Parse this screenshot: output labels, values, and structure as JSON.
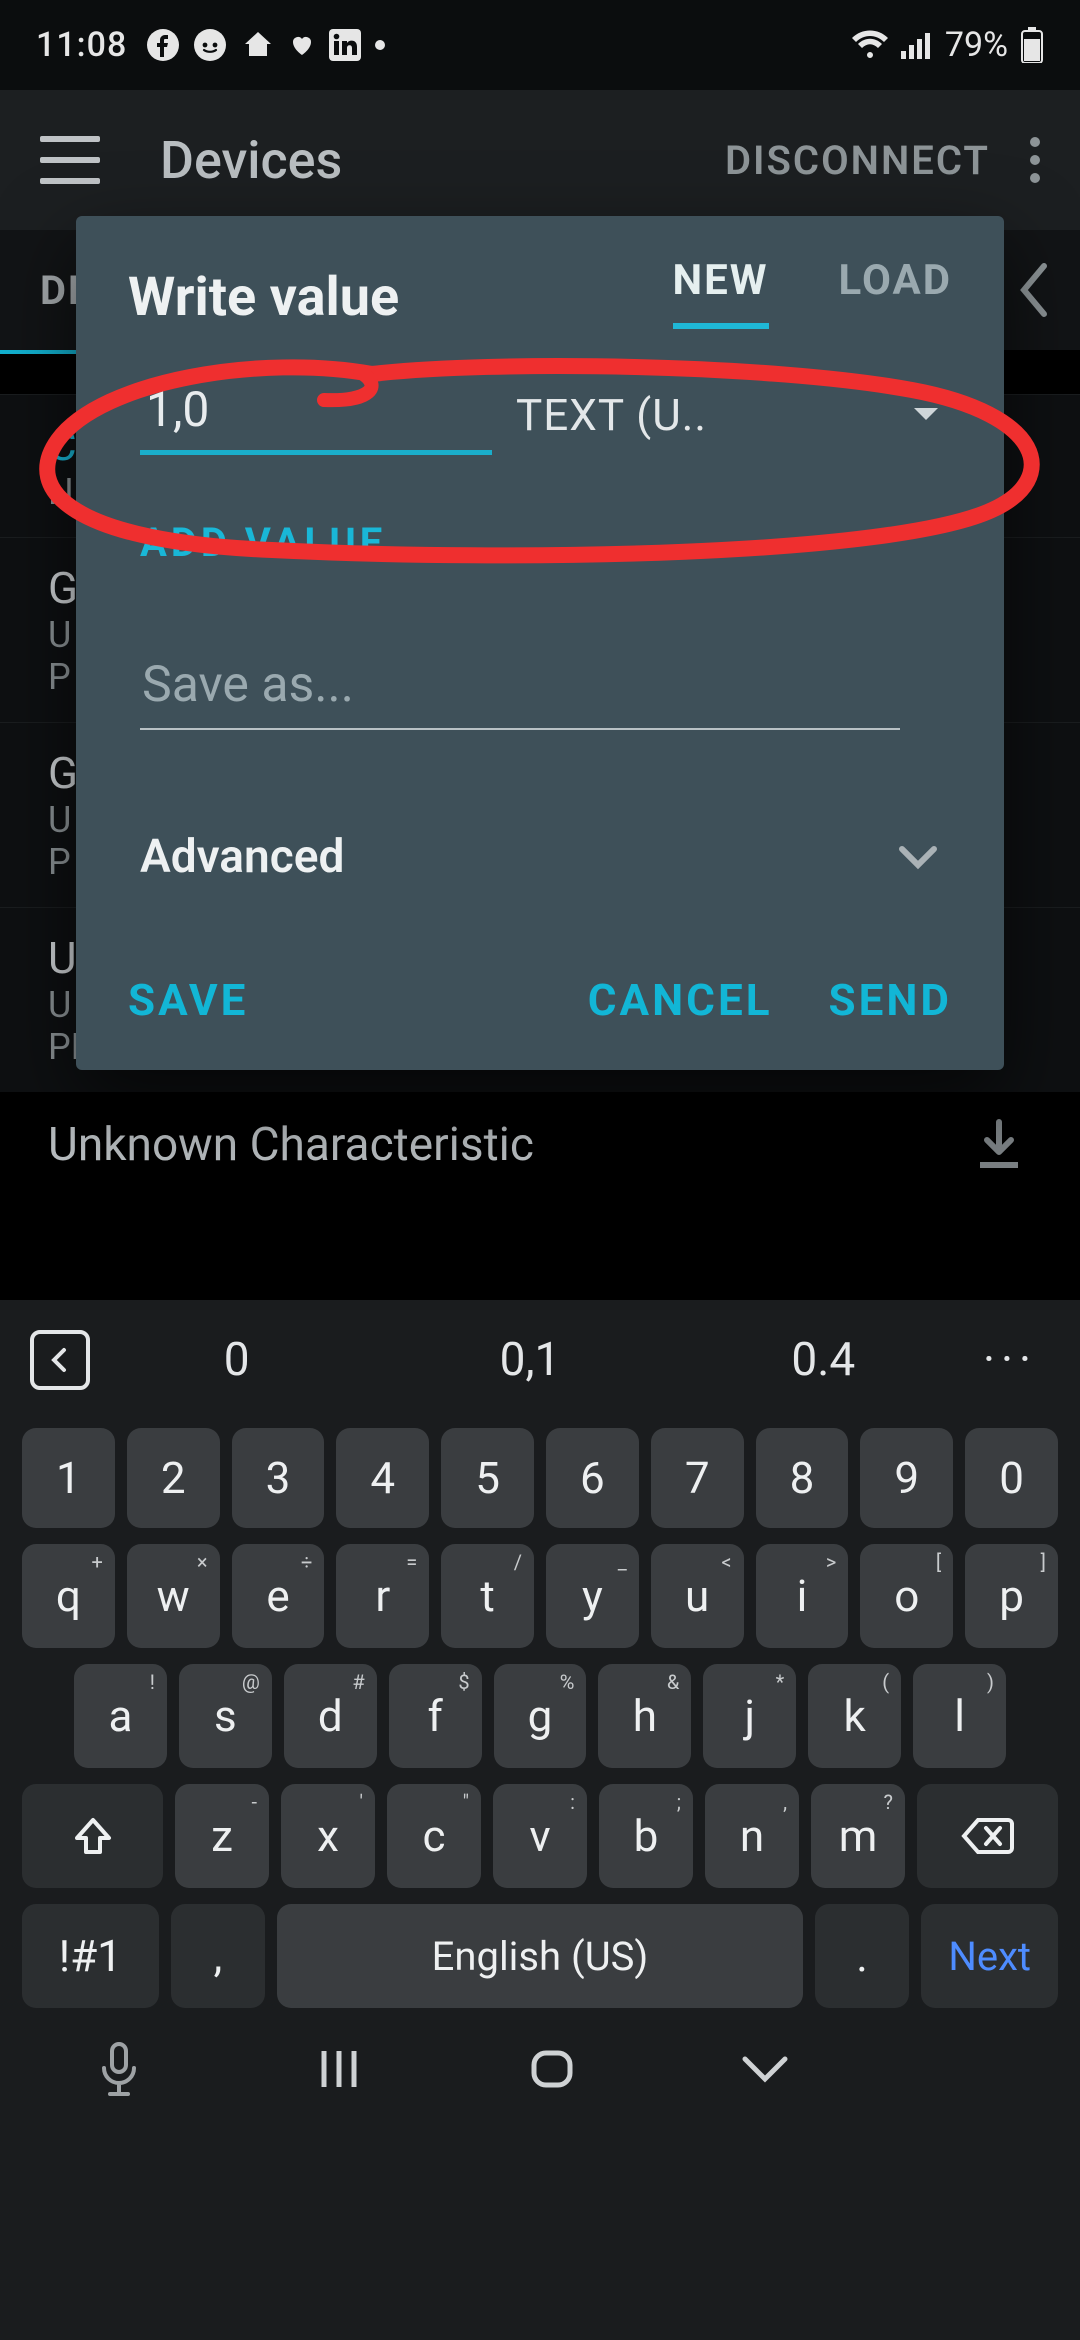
{
  "status": {
    "time": "11:08",
    "battery_pct": "79%",
    "icons_left": [
      "facebook",
      "reddit",
      "home",
      "heart",
      "linkedin",
      "dot"
    ],
    "icons_right": [
      "wifi",
      "signal",
      "battery"
    ]
  },
  "appbar": {
    "title": "Devices",
    "action": "DISCONNECT"
  },
  "bg": {
    "tab_partial": "DED",
    "char_label": "Unknown Characteristic",
    "service_lines": {
      "gname": "G",
      "uline": "U",
      "pline": "PRIMARY SERVICE"
    }
  },
  "dialog": {
    "title": "Write value",
    "tabs": {
      "new": "NEW",
      "load": "LOAD",
      "active": "new"
    },
    "value_input": "1,0",
    "type_label": "TEXT (U..",
    "add_value": "ADD VALUE",
    "save_as_placeholder": "Save as...",
    "advanced": "Advanced",
    "actions": {
      "save": "SAVE",
      "cancel": "CANCEL",
      "send": "SEND"
    }
  },
  "keyboard": {
    "suggestions": [
      "0",
      "0,1",
      "0.4"
    ],
    "row_num": [
      "1",
      "2",
      "3",
      "4",
      "5",
      "6",
      "7",
      "8",
      "9",
      "0"
    ],
    "row1": [
      {
        "k": "q",
        "s": "+"
      },
      {
        "k": "w",
        "s": "×"
      },
      {
        "k": "e",
        "s": "÷"
      },
      {
        "k": "r",
        "s": "="
      },
      {
        "k": "t",
        "s": "/"
      },
      {
        "k": "y",
        "s": "_"
      },
      {
        "k": "u",
        "s": "<"
      },
      {
        "k": "i",
        "s": ">"
      },
      {
        "k": "o",
        "s": "["
      },
      {
        "k": "p",
        "s": "]"
      }
    ],
    "row2": [
      {
        "k": "a",
        "s": "!"
      },
      {
        "k": "s",
        "s": "@"
      },
      {
        "k": "d",
        "s": "#"
      },
      {
        "k": "f",
        "s": "$"
      },
      {
        "k": "g",
        "s": "%"
      },
      {
        "k": "h",
        "s": "&"
      },
      {
        "k": "j",
        "s": "*"
      },
      {
        "k": "k",
        "s": "("
      },
      {
        "k": "l",
        "s": ")"
      }
    ],
    "row3": [
      {
        "k": "z",
        "s": "-"
      },
      {
        "k": "x",
        "s": "'"
      },
      {
        "k": "c",
        "s": "\""
      },
      {
        "k": "v",
        "s": ":"
      },
      {
        "k": "b",
        "s": ";"
      },
      {
        "k": "n",
        "s": ","
      },
      {
        "k": "m",
        "s": "?"
      }
    ],
    "sym": "!#1",
    "comma": ",",
    "space": "English (US)",
    "period": ".",
    "enter": "Next"
  }
}
